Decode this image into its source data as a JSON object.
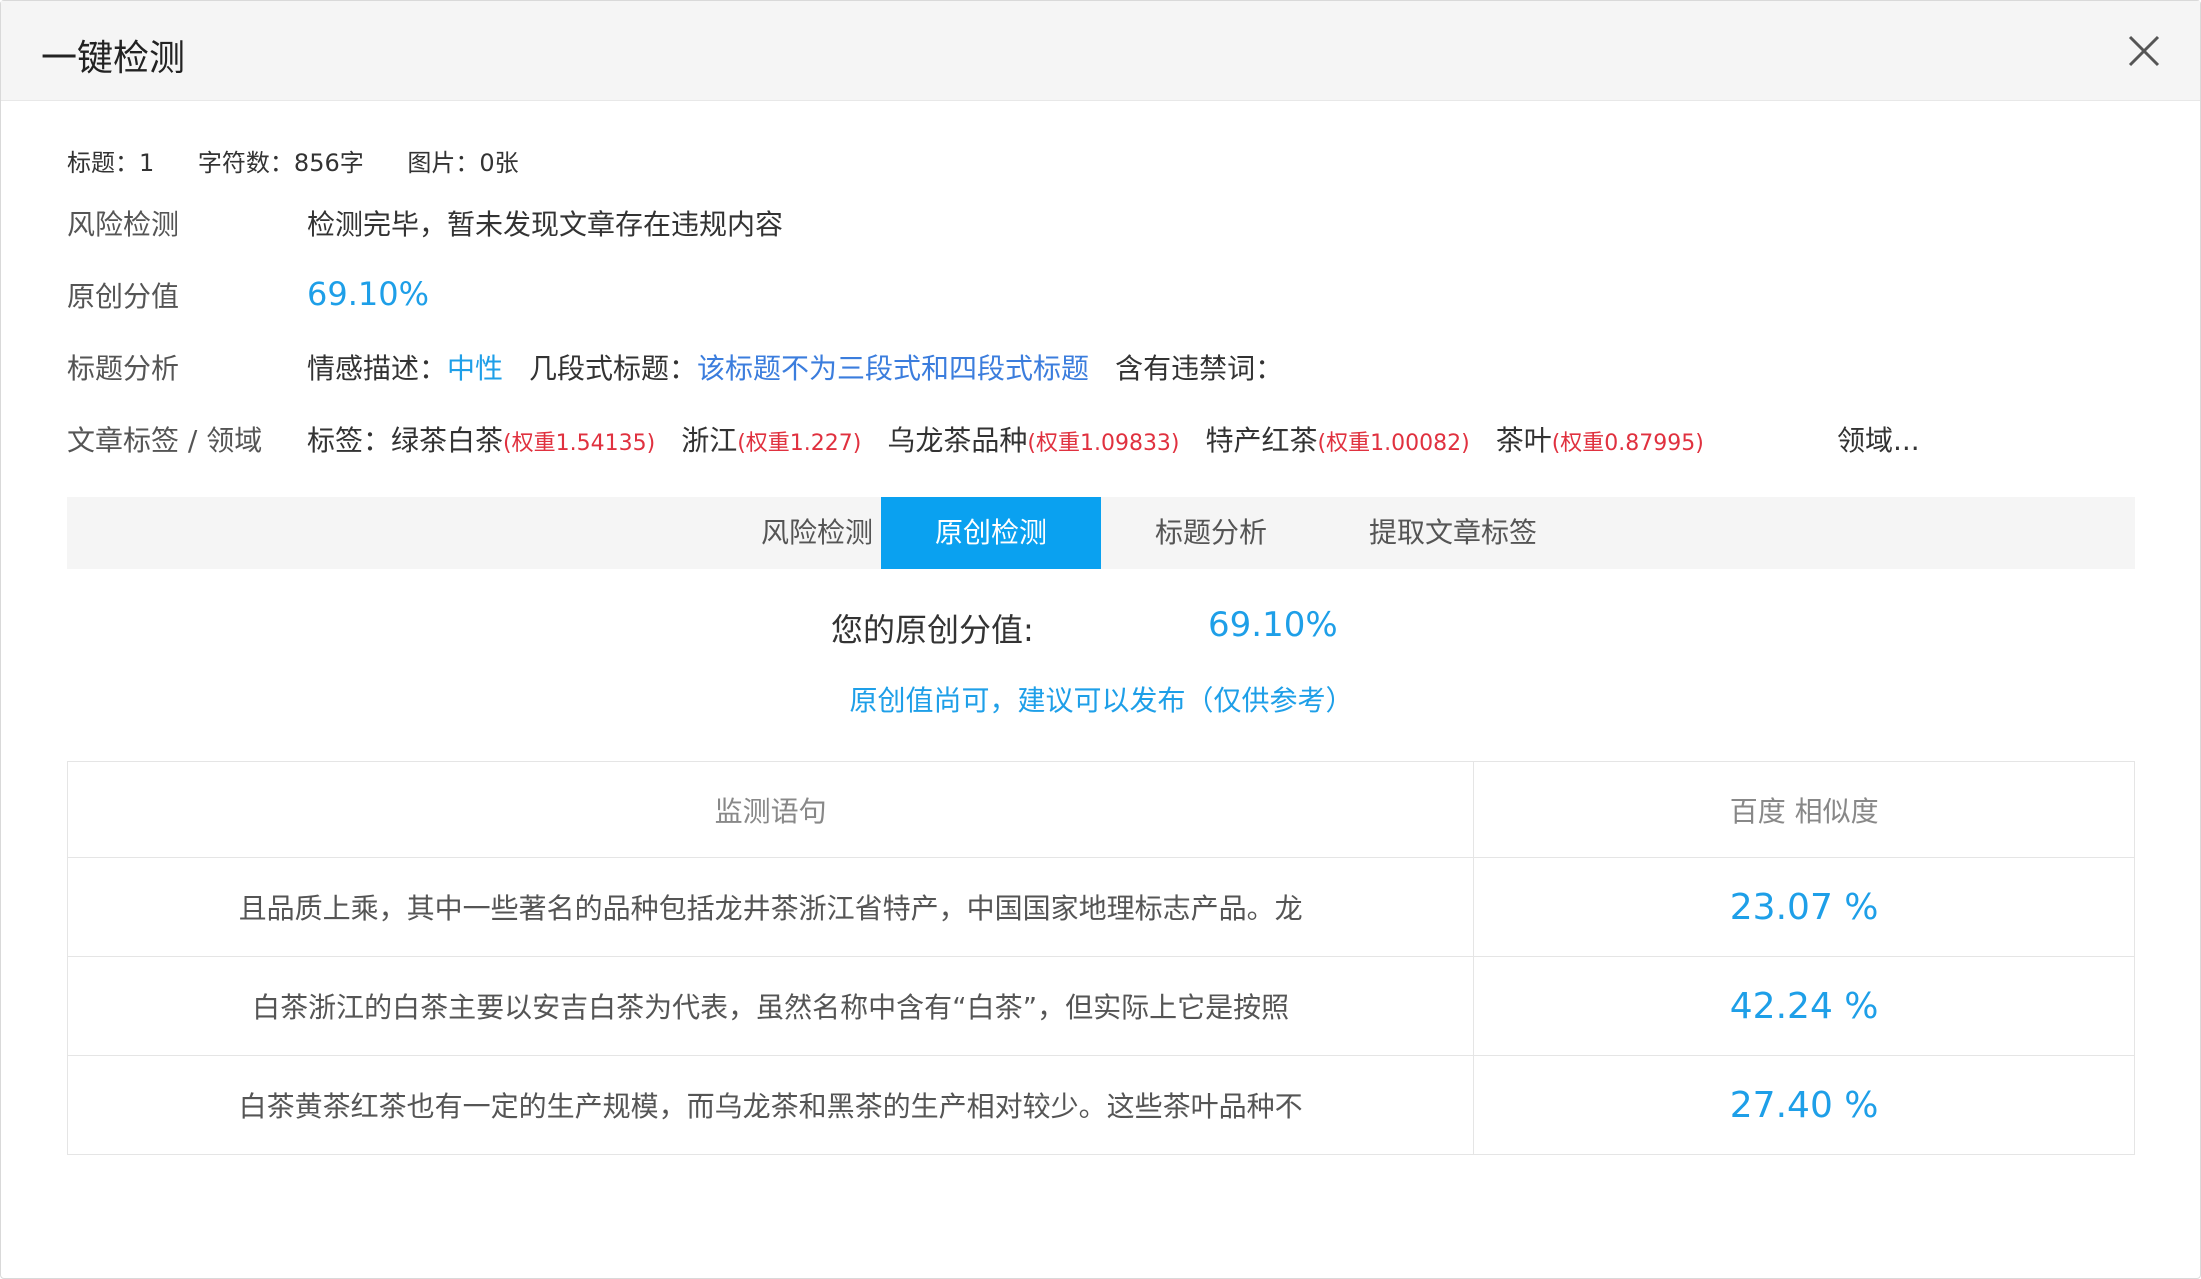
{
  "dialog": {
    "title": "一键检测"
  },
  "meta": {
    "title_count": "标题：1",
    "char_count": "字符数：856字",
    "image_count": "图片：0张"
  },
  "risk": {
    "label": "风险检测",
    "value": "检测完毕，暂未发现文章存在违规内容"
  },
  "originality": {
    "label": "原创分值",
    "value": "69.10%"
  },
  "title_analysis": {
    "label": "标题分析",
    "sentiment_label": "情感描述：",
    "sentiment_value": "中性",
    "segment_label": "几段式标题：",
    "segment_value": "该标题不为三段式和四段式标题",
    "banned_label": "含有违禁词："
  },
  "tags": {
    "label": "文章标签 / 领域",
    "prefix": "标签：",
    "items": [
      {
        "name": "绿茶白茶",
        "weight": "(权重1.54135)"
      },
      {
        "name": "浙江",
        "weight": "(权重1.227)"
      },
      {
        "name": "乌龙茶品种",
        "weight": "(权重1.09833)"
      },
      {
        "name": "特产红茶",
        "weight": "(权重1.00082)"
      },
      {
        "name": "茶叶",
        "weight": "(权重0.87995)"
      }
    ],
    "domain": "领域..."
  },
  "tabs": [
    {
      "label": "风险检测"
    },
    {
      "label": "原创检测"
    },
    {
      "label": "标题分析"
    },
    {
      "label": "提取文章标签"
    }
  ],
  "score": {
    "label": "您的原创分值:",
    "value": "69.10%",
    "advice": "原创值尚可，建议可以发布（仅供参考）"
  },
  "table": {
    "headers": [
      "监测语句",
      "百度 相似度"
    ],
    "rows": [
      {
        "sentence": "且品质上乘，其中一些著名的品种包括龙井茶浙江省特产，中国国家地理标志产品。龙",
        "similarity": "23.07 %"
      },
      {
        "sentence": "白茶浙江的白茶主要以安吉白茶为代表，虽然名称中含有“白茶”，但实际上它是按照",
        "similarity": "42.24 %"
      },
      {
        "sentence": "白茶黄茶红茶也有一定的生产规模，而乌龙茶和黑茶的生产相对较少。这些茶叶品种不",
        "similarity": "27.40 %"
      }
    ]
  },
  "colors": {
    "accent": "#0aa1f0",
    "link": "#1e9fe8",
    "weight_red": "#e0313f"
  },
  "icons": {
    "close": "close-icon"
  }
}
